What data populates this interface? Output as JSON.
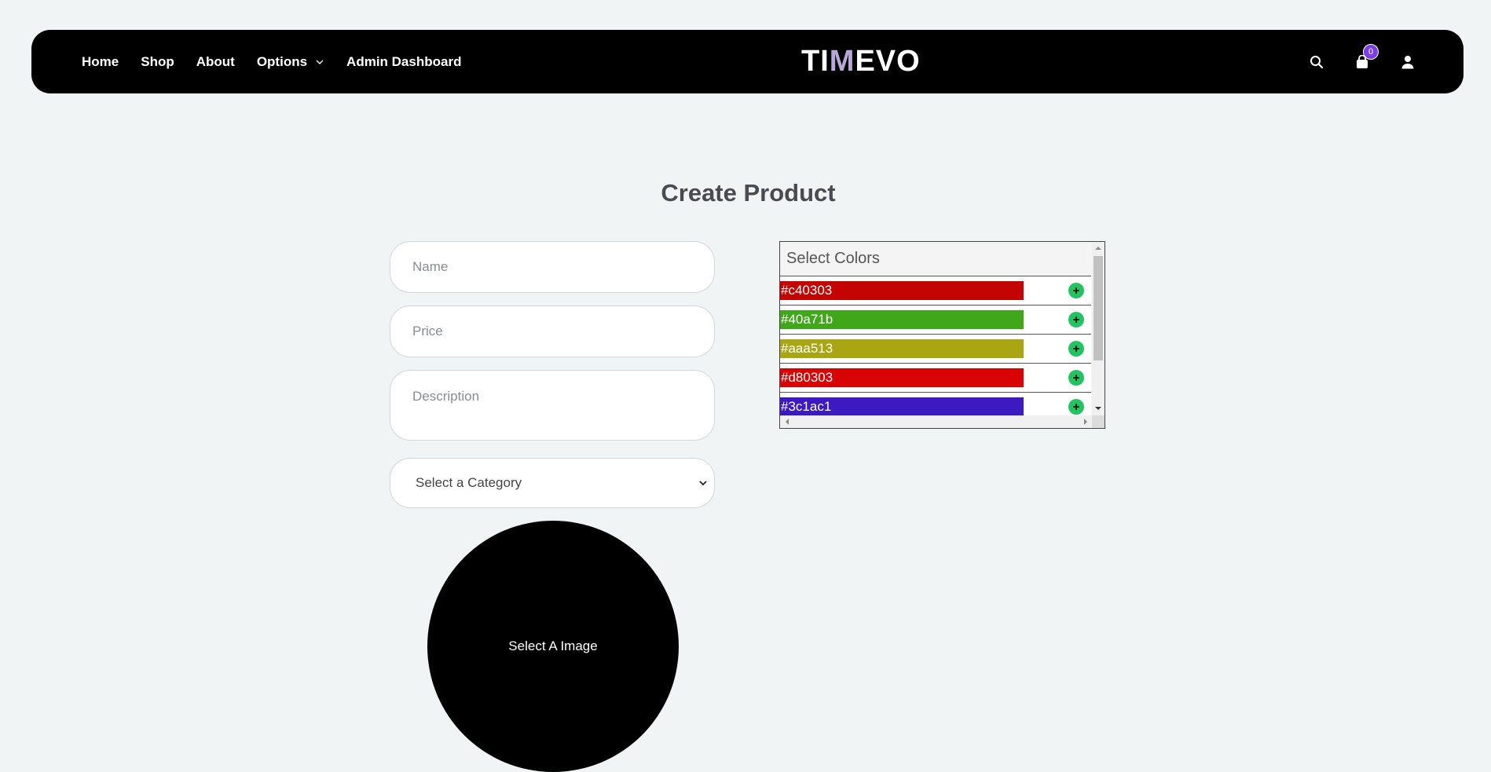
{
  "nav": {
    "links": [
      "Home",
      "Shop",
      "About",
      "Options",
      "Admin Dashboard"
    ],
    "logo_left": "TI",
    "logo_m": "M",
    "logo_right": "EVO",
    "cart_count": "0"
  },
  "page": {
    "title": "Create Product"
  },
  "form": {
    "name_placeholder": "Name",
    "price_placeholder": "Price",
    "description_placeholder": "Description",
    "category_selected": "Select a Category",
    "image_label": "Select A Image"
  },
  "colors": {
    "heading": "Select Colors",
    "items": [
      {
        "label": "#c40303",
        "color": "#c40303"
      },
      {
        "label": "#40a71b",
        "color": "#40a71b"
      },
      {
        "label": "#aaa513",
        "color": "#aaa513"
      },
      {
        "label": "#d80303",
        "color": "#d80303"
      },
      {
        "label": "#3c1ac1",
        "color": "#3c1ac1"
      }
    ]
  },
  "theme": {
    "nav_bg": "#000000",
    "badge": "#7b3fe4",
    "add_button": "#21c461"
  }
}
